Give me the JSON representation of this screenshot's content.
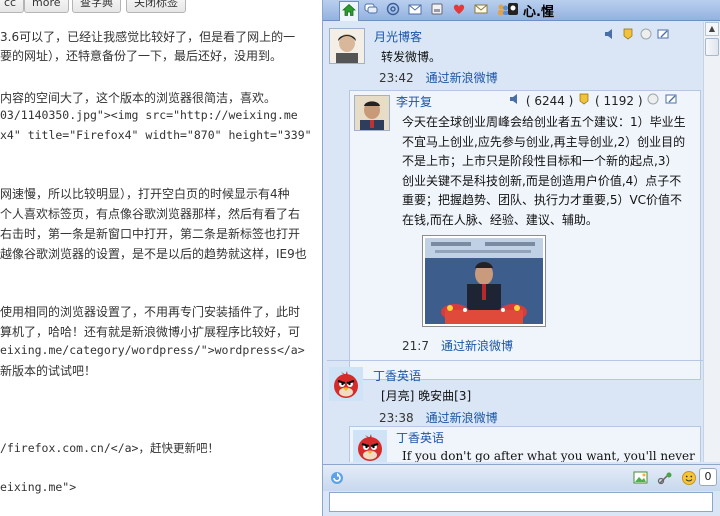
{
  "editor": {
    "buttons": [
      "cc",
      "more",
      "查字典",
      "关闭标签"
    ],
    "lines": [
      {
        "text": "3.6可以了，已经让我感觉比较好了，但是看了网上的一",
        "code": false
      },
      {
        "text": "要的网址），还特意备份了一下，最后还好，没用到。",
        "code": false
      },
      {
        "text": "内容的空间大了，这个版本的浏览器很简洁，喜欢。",
        "code": false
      },
      {
        "text": "03/1140350.jpg\"><img src=\"http://weixing.me",
        "code": true
      },
      {
        "text": "x4\" title=\"Firefox4\" width=\"870\" height=\"339\"",
        "code": true
      },
      {
        "text": "网速慢，所以比较明显），打开空白页的时候显示有4种",
        "code": false
      },
      {
        "text": "个人喜欢标签页，有点像谷歌浏览器那样，然后有看了右",
        "code": false
      },
      {
        "text": "右击时，第一条是新窗口中打开，第二条是新标签也打开",
        "code": false
      },
      {
        "text": "越像谷歌浏览器的设置，是不是以后的趋势就这样，IE9也",
        "code": false
      },
      {
        "text": "使用相同的浏览器设置了，不用再专门安装插件了，此时",
        "code": false
      },
      {
        "text": "算机了，哈哈！还有就是新浪微博小扩展程序比较好，可",
        "code": false
      },
      {
        "text": "eixing.me/category/wordpress/\">wordpress</a>",
        "code": true
      },
      {
        "text": "新版本的试试吧！",
        "code": false
      },
      {
        "text": "/firefox.com.cn/</a>，赶快更新吧！",
        "code": true
      },
      {
        "text": "eixing.me\">",
        "code": true
      }
    ]
  },
  "panel": {
    "title": "心.惺",
    "tabs": [
      "home-icon",
      "comments-icon",
      "at-icon",
      "mail-icon",
      "inbox-icon",
      "favorites-icon",
      "messages-icon",
      "users-icon",
      "profile-icon"
    ],
    "posts": [
      {
        "user": "月光博客",
        "text": "转发微博。",
        "time": "23:42",
        "source": "通过新浪微博",
        "repost": {
          "user": "李开复",
          "reposts": "( 6244 )",
          "comments": "( 1192 )",
          "text": "今天在全球创业周峰会给创业者五个建议：1）毕业生不宜马上创业,应先参与创业,再主导创业,2）创业目的不是上市；上市只是阶段性目标和一个新的起点,3）创业关键不是科技创新,而是创造用户价值,4）点子不重要；把握趋势、团队、执行力才重要,5）VC价值不在钱,而在人脉、经验、建议、辅助。",
          "time": "21:7",
          "source": "通过新浪微博"
        }
      },
      {
        "user": "丁香英语",
        "text": "[月亮] 晚安曲[3]",
        "time": "23:38",
        "source": "通过新浪微博",
        "repost": {
          "user": "丁香英语",
          "text": "If you don't go after what you want, you'll never"
        }
      }
    ],
    "compose": {
      "char_count": "0"
    }
  }
}
